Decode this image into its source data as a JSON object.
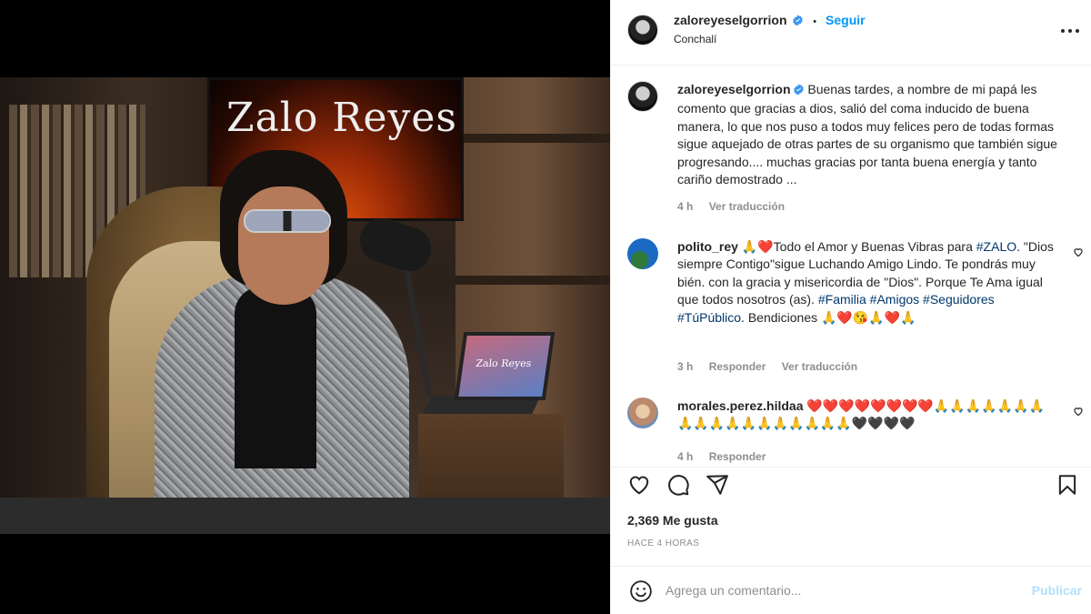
{
  "post_image": {
    "tv_title": "Zalo Reyes",
    "laptop_text": "Zalo Reyes"
  },
  "header": {
    "username": "zaloreyeselgorrion",
    "separator": "•",
    "follow_label": "Seguir",
    "location": "Conchalí"
  },
  "caption": {
    "username": "zaloreyeselgorrion",
    "text": "Buenas tardes, a nombre de mi papá les comento que gracias a dios, salió del coma inducido de buena manera, lo que nos puso a todos muy felices pero de todas formas sigue aquejado de otras partes de su organismo que también sigue progresando.... muchas gracias por tanta buena energía y tanto cariño demostrado ...",
    "time": "4 h",
    "translate": "Ver traducción"
  },
  "comments": [
    {
      "username": "polito_rey",
      "parts": [
        {
          "t": "🙏❤️Todo el Amor y Buenas Vibras para "
        },
        {
          "t": "#ZALO",
          "tag": true
        },
        {
          "t": ". \"Dios siempre Contigo\"sigue Luchando Amigo Lindo. Te pondrás muy bién. con la gracia y misericordia de \"Dios\". Porque Te Ama igual que todos nosotros (as). "
        },
        {
          "t": "#Familia",
          "tag": true
        },
        {
          "t": " "
        },
        {
          "t": "#Amigos",
          "tag": true
        },
        {
          "t": " "
        },
        {
          "t": "#Seguidores",
          "tag": true
        },
        {
          "t": " "
        },
        {
          "t": "#TúPúblico",
          "tag": true
        },
        {
          "t": ". Bendiciones 🙏❤️😘🙏❤️🙏"
        }
      ],
      "time": "3 h",
      "reply": "Responder",
      "translate": "Ver traducción"
    },
    {
      "username": "morales.perez.hildaa",
      "parts": [
        {
          "t": "❤️❤️❤️❤️❤️❤️❤️❤️🙏🙏🙏🙏🙏🙏🙏🙏🙏🙏🙏🙏🙏🙏🙏🙏🙏🙏🖤🖤🖤🖤"
        }
      ],
      "time": "4 h",
      "reply": "Responder"
    }
  ],
  "actions": {
    "likes": "2,369 Me gusta",
    "time_ago": "HACE 4 HORAS"
  },
  "composer": {
    "placeholder": "Agrega un comentario...",
    "publish": "Publicar"
  },
  "colors": {
    "accent": "#0095f6",
    "hashtag": "#00376b",
    "muted": "#8e8e8e",
    "publish_disabled": "#b2dffc"
  },
  "icons": [
    "more-icon",
    "verified-icon",
    "like-icon",
    "comment-icon",
    "share-icon",
    "save-icon",
    "emoji-icon",
    "comment-like-icon"
  ]
}
